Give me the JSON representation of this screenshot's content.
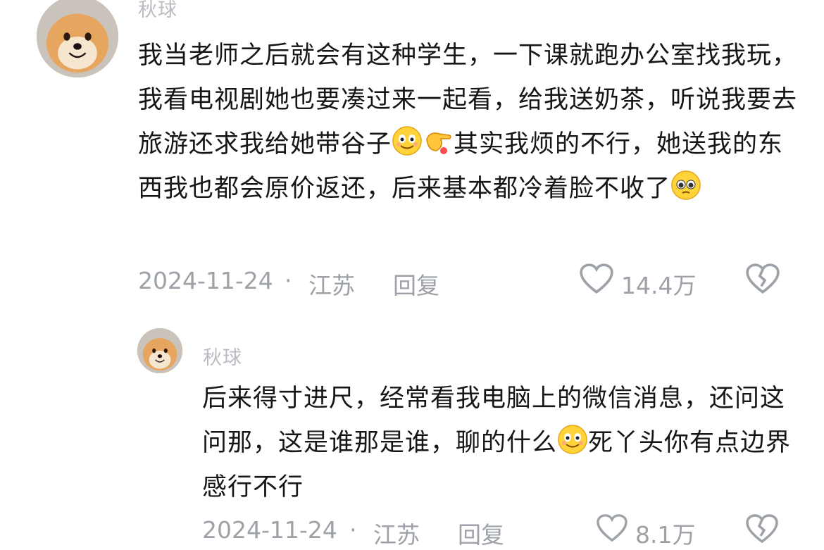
{
  "comments": [
    {
      "username": "秋球",
      "text_parts": [
        "我当老师之后就会有这种学生，一下课就跑办公室找我玩，我看电视剧她也要凑过来一起看，给我送奶茶，听说我要去旅游还求我给她带谷子",
        "其实我烦的不行，她送我的东西我也都会原价返还，后来基本都冷着脸不收了"
      ],
      "date": "2024-11-24",
      "separator": "·",
      "location": "江苏",
      "reply_label": "回复",
      "likes": "14.4万"
    },
    {
      "username": "秋球",
      "text_parts": [
        "后来得寸进尺，经常看我电脑上的微信消息，还问这问那，这是谁那是谁，聊的什么",
        "死丫头你有点边界感行不行"
      ],
      "date": "2024-11-24",
      "separator": "·",
      "location": "江苏",
      "reply_label": "回复",
      "likes": "8.1万"
    }
  ],
  "icons": {
    "avatar": "shiba-dog-avatar",
    "like": "heart-outline-icon",
    "dislike": "broken-heart-icon",
    "emoji_smile": "smile-emoji",
    "emoji_point": "pointing-hand-emoji",
    "emoji_plead": "pleading-face-emoji"
  },
  "colors": {
    "text": "#161616",
    "meta": "#9da1a8",
    "username": "#b9bcc2"
  }
}
